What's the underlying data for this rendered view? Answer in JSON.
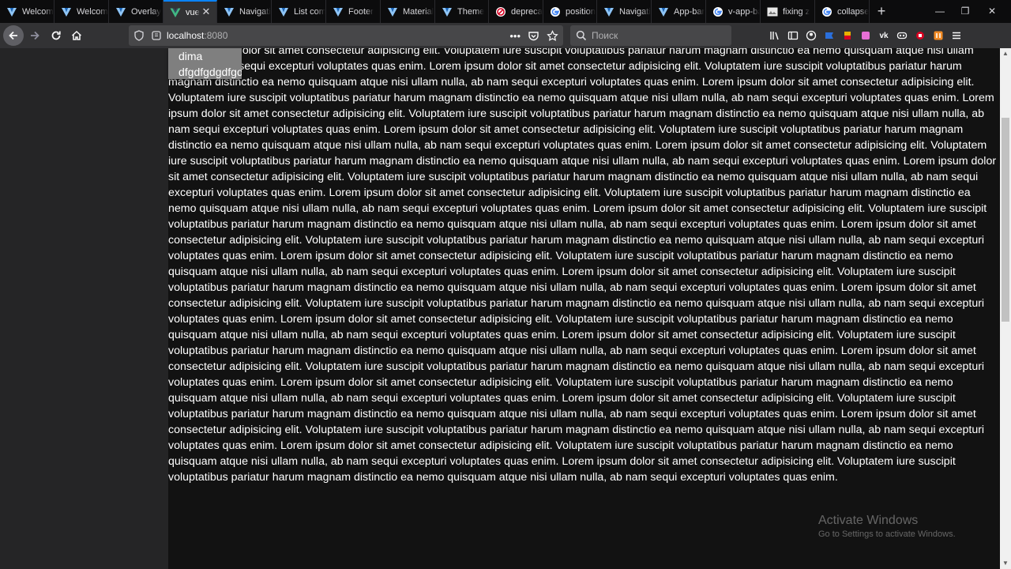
{
  "browser": {
    "tabs": [
      {
        "title": "Welcome",
        "icon": "vuetify-icon",
        "active": false
      },
      {
        "title": "Welcome",
        "icon": "vuetify-icon",
        "active": false
      },
      {
        "title": "Overlay",
        "icon": "vuetify-icon",
        "active": false
      },
      {
        "title": "vue",
        "icon": "vue-icon",
        "active": true
      },
      {
        "title": "Navigation",
        "icon": "vuetify-icon",
        "active": false
      },
      {
        "title": "List component",
        "icon": "vuetify-icon",
        "active": false
      },
      {
        "title": "Footer",
        "icon": "vuetify-icon",
        "active": false
      },
      {
        "title": "Material",
        "icon": "vuetify-icon",
        "active": false
      },
      {
        "title": "Theme",
        "icon": "vuetify-icon",
        "active": false
      },
      {
        "title": "deprecated",
        "icon": "blocked-icon",
        "active": false
      },
      {
        "title": "position",
        "icon": "google-icon",
        "active": false
      },
      {
        "title": "Navigation",
        "icon": "vuetify-icon",
        "active": false
      },
      {
        "title": "App-bar",
        "icon": "vuetify-icon",
        "active": false
      },
      {
        "title": "v-app-bar",
        "icon": "google-icon",
        "active": false
      },
      {
        "title": "fixing z",
        "icon": "image-icon",
        "active": false
      },
      {
        "title": "collapse",
        "icon": "google-icon",
        "active": false
      }
    ],
    "url_host": "localhost",
    "url_port": ":8080",
    "search_placeholder": "Поиск",
    "page_actions": "•••"
  },
  "menu": {
    "items": [
      "dima",
      "dfgdfgdgdfgdfg"
    ]
  },
  "content": {
    "paragraph": "Lorem ipsum dolor sit amet consectetur adipisicing elit. Voluptatem iure suscipit voluptatibus pariatur harum magnam distinctio ea nemo quisquam atque nisi ullam nulla, ab nam sequi excepturi voluptates quas enim. Lorem ipsum dolor sit amet consectetur adipisicing elit. Voluptatem iure suscipit voluptatibus pariatur harum magnam distinctio ea nemo quisquam atque nisi ullam nulla, ab nam sequi excepturi voluptates quas enim. Lorem ipsum dolor sit amet consectetur adipisicing elit. Voluptatem iure suscipit voluptatibus pariatur harum magnam distinctio ea nemo quisquam atque nisi ullam nulla, ab nam sequi excepturi voluptates quas enim. Lorem ipsum dolor sit amet consectetur adipisicing elit. Voluptatem iure suscipit voluptatibus pariatur harum magnam distinctio ea nemo quisquam atque nisi ullam nulla, ab nam sequi excepturi voluptates quas enim. Lorem ipsum dolor sit amet consectetur adipisicing elit. Voluptatem iure suscipit voluptatibus pariatur harum magnam distinctio ea nemo quisquam atque nisi ullam nulla, ab nam sequi excepturi voluptates quas enim. Lorem ipsum dolor sit amet consectetur adipisicing elit. Voluptatem iure suscipit voluptatibus pariatur harum magnam distinctio ea nemo quisquam atque nisi ullam nulla, ab nam sequi excepturi voluptates quas enim. Lorem ipsum dolor sit amet consectetur adipisicing elit. Voluptatem iure suscipit voluptatibus pariatur harum magnam distinctio ea nemo quisquam atque nisi ullam nulla, ab nam sequi excepturi voluptates quas enim. Lorem ipsum dolor sit amet consectetur adipisicing elit. Voluptatem iure suscipit voluptatibus pariatur harum magnam distinctio ea nemo quisquam atque nisi ullam nulla, ab nam sequi excepturi voluptates quas enim. Lorem ipsum dolor sit amet consectetur adipisicing elit. Voluptatem iure suscipit voluptatibus pariatur harum magnam distinctio ea nemo quisquam atque nisi ullam nulla, ab nam sequi excepturi voluptates quas enim. Lorem ipsum dolor sit amet consectetur adipisicing elit. Voluptatem iure suscipit voluptatibus pariatur harum magnam distinctio ea nemo quisquam atque nisi ullam nulla, ab nam sequi excepturi voluptates quas enim. Lorem ipsum dolor sit amet consectetur adipisicing elit. Voluptatem iure suscipit voluptatibus pariatur harum magnam distinctio ea nemo quisquam atque nisi ullam nulla, ab nam sequi excepturi voluptates quas enim. Lorem ipsum dolor sit amet consectetur adipisicing elit. Voluptatem iure suscipit voluptatibus pariatur harum magnam distinctio ea nemo quisquam atque nisi ullam nulla, ab nam sequi excepturi voluptates quas enim. Lorem ipsum dolor sit amet consectetur adipisicing elit. Voluptatem iure suscipit voluptatibus pariatur harum magnam distinctio ea nemo quisquam atque nisi ullam nulla, ab nam sequi excepturi voluptates quas enim. Lorem ipsum dolor sit amet consectetur adipisicing elit. Voluptatem iure suscipit voluptatibus pariatur harum magnam distinctio ea nemo quisquam atque nisi ullam nulla, ab nam sequi excepturi voluptates quas enim. Lorem ipsum dolor sit amet consectetur adipisicing elit. Voluptatem iure suscipit voluptatibus pariatur harum magnam distinctio ea nemo quisquam atque nisi ullam nulla, ab nam sequi excepturi voluptates quas enim. Lorem ipsum dolor sit amet consectetur adipisicing elit. Voluptatem iure suscipit voluptatibus pariatur harum magnam distinctio ea nemo quisquam atque nisi ullam nulla, ab nam sequi excepturi voluptates quas enim. Lorem ipsum dolor sit amet consectetur adipisicing elit. Voluptatem iure suscipit voluptatibus pariatur harum magnam distinctio ea nemo quisquam atque nisi ullam nulla, ab nam sequi excepturi voluptates quas enim. Lorem ipsum dolor sit amet consectetur adipisicing elit. Voluptatem iure suscipit voluptatibus pariatur harum magnam distinctio ea nemo quisquam atque nisi ullam nulla, ab nam sequi excepturi voluptates quas enim. Lorem ipsum dolor sit amet consectetur adipisicing elit. Voluptatem iure suscipit voluptatibus pariatur harum magnam distinctio ea nemo quisquam atque nisi ullam nulla, ab nam sequi excepturi voluptates quas enim. Lorem ipsum dolor sit amet consectetur adipisicing elit. Voluptatem iure suscipit voluptatibus pariatur harum magnam distinctio ea nemo quisquam atque nisi ullam nulla, ab nam sequi excepturi voluptates quas enim. Lorem ipsum dolor sit amet consectetur adipisicing elit. Voluptatem iure suscipit voluptatibus pariatur harum magnam distinctio ea nemo quisquam atque nisi ullam nulla, ab nam sequi excepturi voluptates quas enim."
  },
  "watermark": {
    "title": "Activate Windows",
    "subtitle": "Go to Settings to activate Windows."
  },
  "colors": {
    "tab_active_accent": "#0a84ff",
    "content_background": "#121212",
    "left_column": "#252526",
    "menu_background": "#7f7f7f"
  }
}
